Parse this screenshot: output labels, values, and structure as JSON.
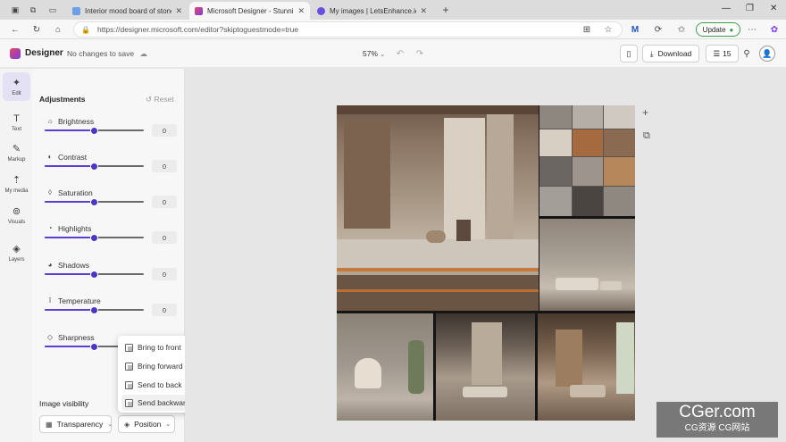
{
  "browser": {
    "tabs": [
      {
        "title": "Interior mood board of stone, co",
        "active": false
      },
      {
        "title": "Microsoft Designer - Stunning de",
        "active": true
      },
      {
        "title": "My images | LetsEnhance.io - Ima",
        "active": false
      }
    ],
    "url": "https://designer.microsoft.com/editor?skiptoguestmode=true",
    "update_label": "Update"
  },
  "app": {
    "name": "Designer",
    "save_status": "No changes to save",
    "zoom": "57%",
    "download_label": "Download",
    "credits": "15"
  },
  "rail": [
    {
      "label": "Edit",
      "icon": "sparkle-icon",
      "active": true
    },
    {
      "label": "Text",
      "icon": "text-icon",
      "active": false
    },
    {
      "label": "Markup",
      "icon": "pen-icon",
      "active": false
    },
    {
      "label": "My media",
      "icon": "upload-icon",
      "active": false
    },
    {
      "label": "Visuals",
      "icon": "shapes-icon",
      "active": false
    },
    {
      "label": "Layers",
      "icon": "layers-icon",
      "active": false
    }
  ],
  "adjustments": {
    "title": "Adjustments",
    "reset_label": "Reset",
    "items": [
      {
        "label": "Brightness",
        "value": "0",
        "level": 0.5
      },
      {
        "label": "Contrast",
        "value": "0",
        "level": 0.5
      },
      {
        "label": "Saturation",
        "value": "0",
        "level": 0.5
      },
      {
        "label": "Highlights",
        "value": "0",
        "level": 0.5
      },
      {
        "label": "Shadows",
        "value": "0",
        "level": 0.5
      },
      {
        "label": "Temperature",
        "value": "0",
        "level": 0.5
      },
      {
        "label": "Sharpness",
        "value": "",
        "level": 0.5
      }
    ]
  },
  "visibility": {
    "title": "Image visibility",
    "transparency_label": "Transparency",
    "position_label": "Position"
  },
  "position_menu": [
    {
      "label": "Bring to front"
    },
    {
      "label": "Bring forward"
    },
    {
      "label": "Send to back"
    },
    {
      "label": "Send backward"
    }
  ],
  "watermark": {
    "line1": "CGer.com",
    "line2": "CG资源  CG网站"
  },
  "colors": {
    "accent": "#5b3fd0",
    "update_border": "#3b9d50"
  }
}
